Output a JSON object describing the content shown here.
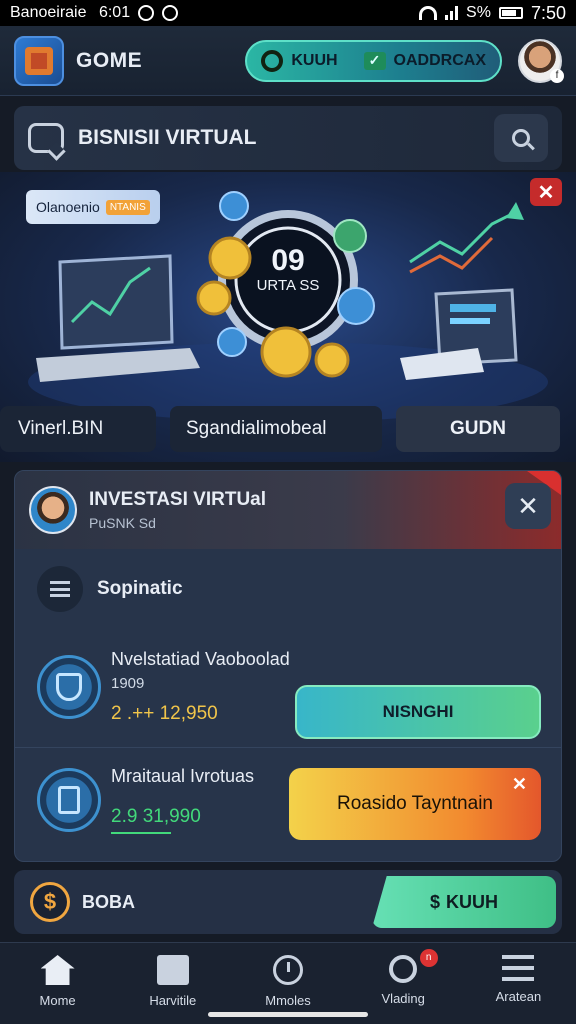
{
  "status_bar": {
    "left_text": "Banoeiraie  6:01",
    "battery": "S%",
    "time": "7:50"
  },
  "header": {
    "app_title": "GOME",
    "pill_1": "KUUH",
    "pill_2": "OADDRCAX",
    "avatar_badge": "f"
  },
  "business": {
    "title": "BISNISII VIRTUAL"
  },
  "banner": {
    "tag_text": "Olanoenio",
    "tag_mini": "NTANIS",
    "timer_value": "09",
    "timer_label": "URTA SS",
    "buttons": [
      "Vinerl.BIN",
      "Sgandialimobeal",
      "GUDN"
    ]
  },
  "invest_card": {
    "title": "INVESTASI VIRTUal",
    "subtitle": "PuSNK Sd",
    "section_label": "Sopinatic",
    "items": [
      {
        "name": "Nvelstatiad Vaoboolad",
        "sub": "1909",
        "amount": "2 .++ 12,950",
        "cta": "NISNGHI"
      },
      {
        "name": "Mraitaual Ivrotuas",
        "sub": "",
        "amount": "2.9 31,990",
        "cta": "Roasido Tayntnain"
      }
    ]
  },
  "bottom_card": {
    "label": "BOBA",
    "button": "KUUH"
  },
  "nav": {
    "items": [
      {
        "label": "Mome",
        "icon": "home-icon"
      },
      {
        "label": "Harvitile",
        "icon": "chart-icon"
      },
      {
        "label": "Mmoles",
        "icon": "clock-icon"
      },
      {
        "label": "Vlading",
        "icon": "search-icon",
        "badge": "n"
      },
      {
        "label": "Aratean",
        "icon": "menu-icon"
      }
    ]
  },
  "colors": {
    "accent_teal": "#2bb6a4",
    "alert_red": "#c52b2b",
    "amount_yellow": "#f1c54a",
    "amount_green": "#42d97b"
  }
}
